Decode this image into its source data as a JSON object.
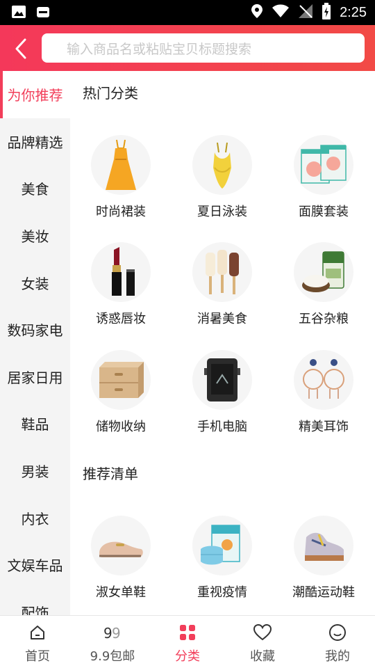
{
  "status_bar": {
    "time": "2:25"
  },
  "search": {
    "placeholder": "输入商品名或粘贴宝贝标题搜索"
  },
  "sidebar": {
    "items": [
      {
        "label": "为你推荐",
        "active": true
      },
      {
        "label": "品牌精选"
      },
      {
        "label": "美食"
      },
      {
        "label": "美妆"
      },
      {
        "label": "女装"
      },
      {
        "label": "数码家电"
      },
      {
        "label": "居家日用"
      },
      {
        "label": "鞋品"
      },
      {
        "label": "男装"
      },
      {
        "label": "内衣"
      },
      {
        "label": "文娱车品"
      },
      {
        "label": "配饰"
      }
    ]
  },
  "main": {
    "hot_title": "热门分类",
    "hot_items": [
      {
        "label": "时尚裙装",
        "icon": "dress-image"
      },
      {
        "label": "夏日泳装",
        "icon": "swimsuit-image"
      },
      {
        "label": "面膜套装",
        "icon": "facemask-box-image"
      },
      {
        "label": "诱惑唇妆",
        "icon": "lipstick-image"
      },
      {
        "label": "消暑美食",
        "icon": "icecream-image"
      },
      {
        "label": "五谷杂粮",
        "icon": "rice-bag-image"
      },
      {
        "label": "储物收纳",
        "icon": "storage-drawer-image"
      },
      {
        "label": "手机电脑",
        "icon": "rugged-phone-image"
      },
      {
        "label": "精美耳饰",
        "icon": "earrings-image"
      }
    ],
    "rec_title": "推荐清单",
    "rec_items": [
      {
        "label": "淑女单鞋",
        "icon": "loafer-image"
      },
      {
        "label": "重视疫情",
        "icon": "face-mask-image"
      },
      {
        "label": "潮酷运动鞋",
        "icon": "sneaker-image"
      }
    ]
  },
  "bottom_nav": {
    "items": [
      {
        "label": "首页",
        "icon": "home-icon"
      },
      {
        "label": "9.9包邮",
        "icon": "nine-nine-icon"
      },
      {
        "label": "分类",
        "icon": "category-grid-icon",
        "active": true
      },
      {
        "label": "收藏",
        "icon": "heart-icon"
      },
      {
        "label": "我的",
        "icon": "profile-smile-icon"
      }
    ]
  },
  "colors": {
    "accent": "#f23e5a",
    "header_start": "#f4385a",
    "header_end": "#f24a46"
  }
}
